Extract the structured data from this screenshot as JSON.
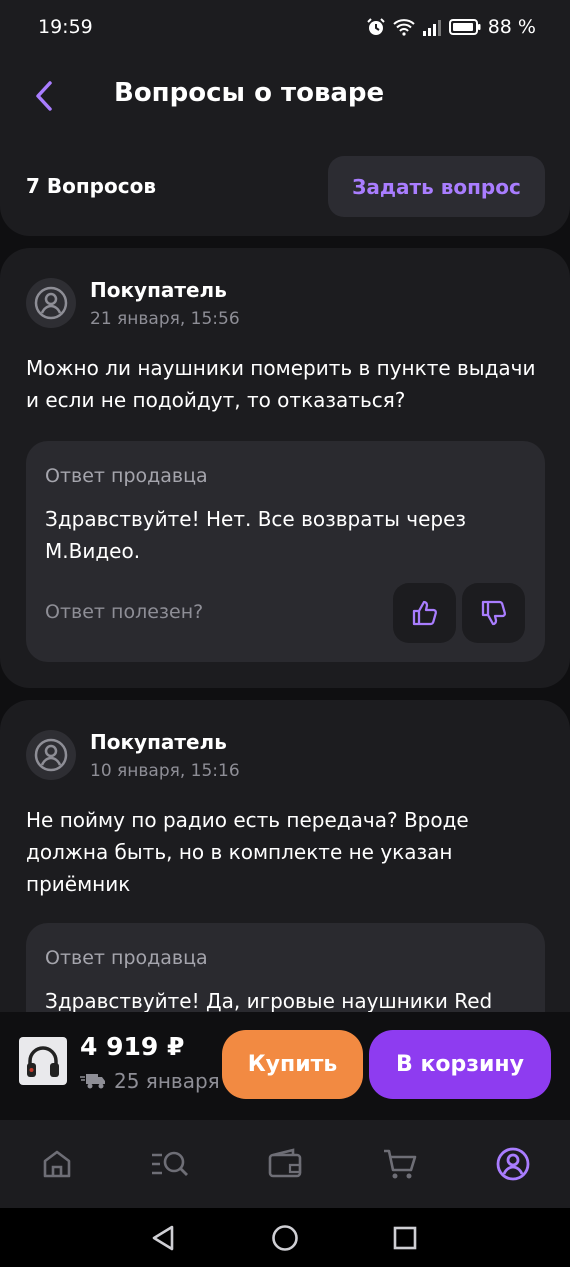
{
  "status_bar": {
    "time": "19:59",
    "battery": "88 %"
  },
  "header": {
    "title": "Вопросы о товаре",
    "count_label": "7 Вопросов",
    "ask_button": "Задать вопрос"
  },
  "questions": [
    {
      "author": "Покупатель",
      "date": "21 января, 15:56",
      "text": "Можно ли наушники померить в пункте выдачи и если не подойдут, то отказаться?",
      "answer": {
        "title": "Ответ продавца",
        "text": "Здравствуйте! Нет. Все возвраты через М.Видео.",
        "helpful_label": "Ответ полезен?"
      }
    },
    {
      "author": "Покупатель",
      "date": "10 января, 15:16",
      "text": "Не пойму по радио есть передача? Вроде должна быть, но в комплекте не указан приёмник",
      "answer": {
        "title": "Ответ продавца",
        "text": "Здравствуйте! Да, игровые наушники Red"
      }
    }
  ],
  "buy_bar": {
    "price": "4 919 ₽",
    "delivery": "25 января",
    "buy_button": "Купить",
    "cart_button": "В корзину"
  },
  "tabs": [
    "home-icon",
    "catalog-search-icon",
    "wallet-icon",
    "cart-icon",
    "profile-icon"
  ],
  "colors": {
    "accent": "#a97dff",
    "buy": "#f28a42",
    "cart": "#8e3cf0",
    "card": "#1c1c1f",
    "background": "#0f0f11"
  }
}
